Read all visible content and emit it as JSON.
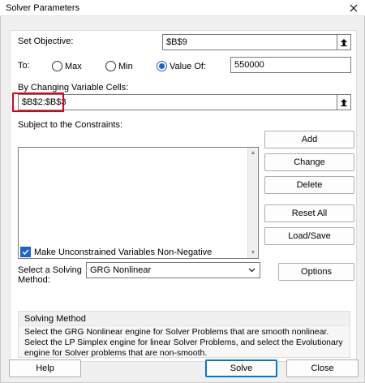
{
  "window": {
    "title": "Solver Parameters"
  },
  "objective": {
    "label": "Set Objective:",
    "value": "$B$9"
  },
  "to": {
    "label": "To:",
    "options": [
      {
        "label": "Max",
        "checked": false
      },
      {
        "label": "Min",
        "checked": false
      },
      {
        "label": "Value Of:",
        "checked": true
      }
    ],
    "value_of": "550000"
  },
  "changing": {
    "label": "By Changing Variable Cells:",
    "value": "$B$2:$B$3"
  },
  "constraints": {
    "label": "Subject to the Constraints:"
  },
  "side_buttons": {
    "add": "Add",
    "change": "Change",
    "delete": "Delete",
    "reset_all": "Reset All",
    "load_save": "Load/Save"
  },
  "nonneg": {
    "label": "Make Unconstrained Variables Non-Negative",
    "checked": true
  },
  "method": {
    "label_line1": "Select a Solving",
    "label_line2": "Method:",
    "selected": "GRG Nonlinear",
    "options_button": "Options"
  },
  "solving_method": {
    "title": "Solving Method",
    "text": "Select the GRG Nonlinear engine for Solver Problems that are smooth nonlinear. Select the LP Simplex engine for linear Solver Problems, and select the Evolutionary engine for Solver problems that are non-smooth."
  },
  "footer": {
    "help": "Help",
    "solve": "Solve",
    "close": "Close"
  },
  "colors": {
    "accent": "#1c64c9",
    "highlight": "#e0001b",
    "focus": "#0078d7"
  }
}
